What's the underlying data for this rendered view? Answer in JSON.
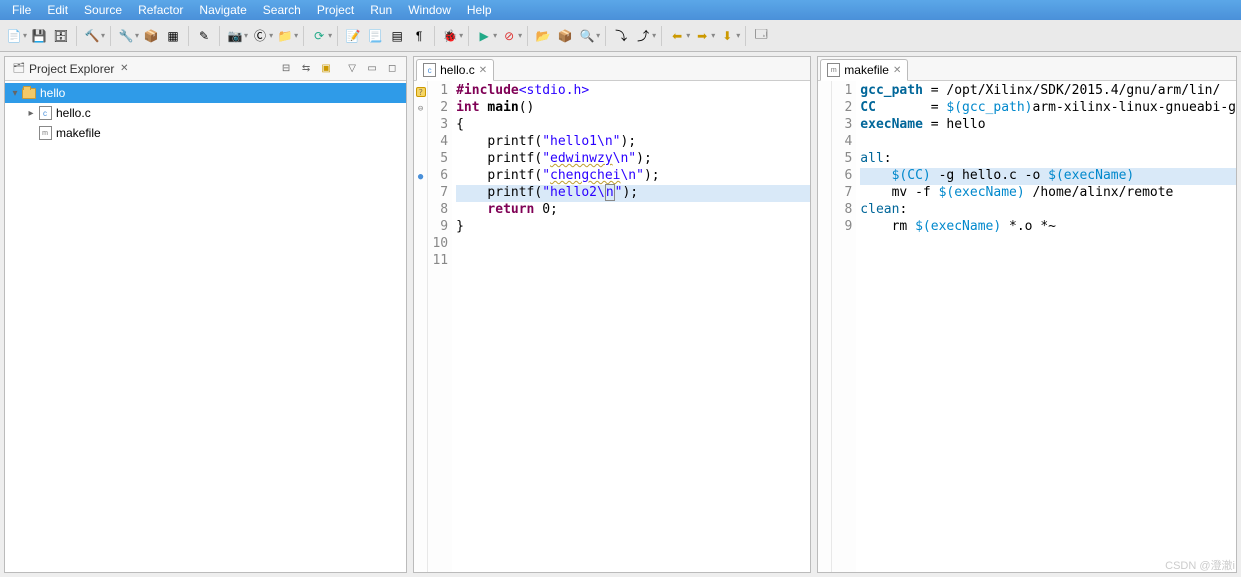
{
  "menubar": [
    "File",
    "Edit",
    "Source",
    "Refactor",
    "Navigate",
    "Search",
    "Project",
    "Run",
    "Window",
    "Help"
  ],
  "explorer": {
    "title": "Project Explorer",
    "tree": [
      {
        "depth": 0,
        "expanded": true,
        "icon": "folder",
        "label": "hello",
        "selected": true
      },
      {
        "depth": 1,
        "expanded": false,
        "toggle": "▸",
        "icon": "cfile",
        "label": "hello.c"
      },
      {
        "depth": 1,
        "expanded": null,
        "icon": "mfile",
        "label": "makefile"
      }
    ]
  },
  "editor1": {
    "tab": "hello.c",
    "lines": [
      {
        "n": 1,
        "mark": "?",
        "html": "<span class=\"pp\">#include</span><span class=\"inc\">&lt;stdio.h&gt;</span>"
      },
      {
        "n": 2,
        "mark": "⊖",
        "html": "<span class=\"kw\">int</span> <span style=\"font-weight:bold\">main</span>()"
      },
      {
        "n": 3,
        "html": "{"
      },
      {
        "n": 4,
        "html": "    printf(<span class=\"str\">\"hello1\\n\"</span>);"
      },
      {
        "n": 5,
        "html": "    printf(<span class=\"str\">\"<span class=\"squiggle\">edwinwzy</span>\\n\"</span>);"
      },
      {
        "n": 6,
        "mark": "●",
        "html": "    printf(<span class=\"str\">\"<span class=\"squiggle\">chengchei</span>\\n\"</span>);"
      },
      {
        "n": 7,
        "hl": true,
        "html": "    printf(<span class=\"str\">\"hello2\\<span class=\"caret-box\">n</span>\"</span>);"
      },
      {
        "n": 8,
        "html": "    <span class=\"kw\">return</span> 0;"
      },
      {
        "n": 9,
        "html": "}"
      },
      {
        "n": 10,
        "html": ""
      },
      {
        "n": 11,
        "html": ""
      }
    ]
  },
  "editor2": {
    "tab": "makefile",
    "lines": [
      {
        "n": 1,
        "html": "<span class=\"mkvar\">gcc_path</span> = /opt/Xilinx/SDK/2015.4/gnu/arm/lin/"
      },
      {
        "n": 2,
        "html": "<span class=\"mkvar\">CC</span>       = <span class=\"mkref\">$(gcc_path)</span>arm-xilinx-linux-gnueabi-g"
      },
      {
        "n": 3,
        "html": "<span class=\"mkvar\">execName</span> = hello"
      },
      {
        "n": 4,
        "html": ""
      },
      {
        "n": 5,
        "html": "<span class=\"mktarget\">all</span>:"
      },
      {
        "n": 6,
        "hl": true,
        "html": "    <span class=\"mkref\">$(CC)</span> -g hello.c -o <span class=\"mkref\">$(execName)</span>"
      },
      {
        "n": 7,
        "html": "    mv -f <span class=\"mkref\">$(execName)</span> /home/alinx/remote"
      },
      {
        "n": 8,
        "html": "<span class=\"mktarget\">clean</span>:"
      },
      {
        "n": 9,
        "html": "    rm <span class=\"mkref\">$(execName)</span> *.o *~"
      }
    ]
  },
  "watermark": "CSDN @澄澈i"
}
